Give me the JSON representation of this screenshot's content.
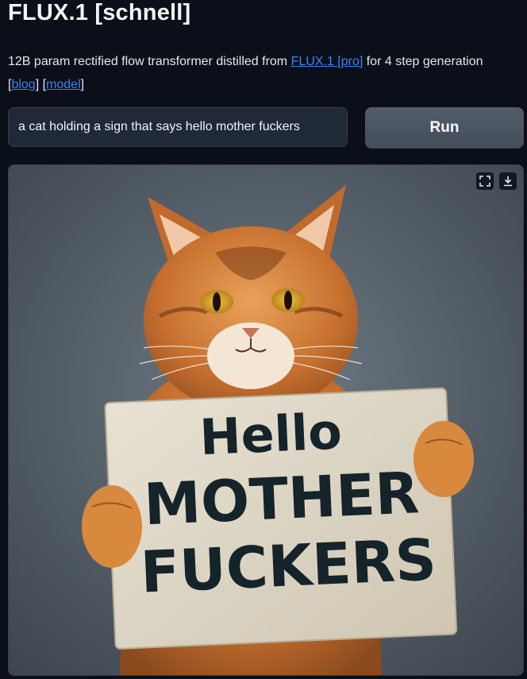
{
  "header": {
    "title": "FLUX.1 [schnell]"
  },
  "description": {
    "text_before": "12B param rectified flow transformer distilled from ",
    "pro_link": "FLUX.1 [pro]",
    "text_after": " for 4 step generation",
    "bracket_open": "[",
    "blog_link": "blog",
    "bracket_mid": "] [",
    "model_link": "model",
    "bracket_close": "]"
  },
  "prompt": {
    "value": "a cat holding a sign that says hello mother fuckers"
  },
  "run_button": {
    "label": "Run"
  },
  "result": {
    "sign_lines": [
      "Hello",
      "MOTHER",
      "FUCKERS"
    ],
    "toolbar_icons": [
      "fullscreen-icon",
      "download-icon"
    ]
  },
  "colors": {
    "background": "#0b0f19",
    "link": "#3b82f6",
    "button": "#4b5563",
    "input": "#1f2937"
  }
}
